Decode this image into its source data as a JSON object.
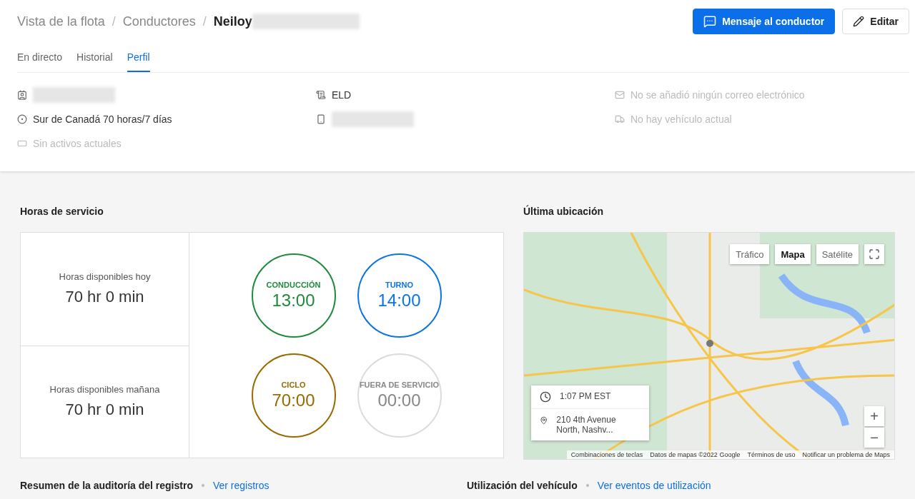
{
  "breadcrumb": {
    "separator": "/",
    "items": [
      {
        "label": "Vista de la flota",
        "current": false
      },
      {
        "label": "Conductores",
        "current": false
      },
      {
        "label": "Neiloy",
        "current": true
      }
    ]
  },
  "actions": {
    "message": "Mensaje al conductor",
    "edit": "Editar"
  },
  "tabs": [
    {
      "label": "En directo",
      "selected": false
    },
    {
      "label": "Historial",
      "selected": false
    },
    {
      "label": "Perfil",
      "selected": true
    }
  ],
  "details": [
    {
      "muted": false,
      "redacted": true
    },
    {
      "text": "ELD",
      "muted": false,
      "redacted": false
    },
    {
      "text": "No se añadió ningún correo electrónico",
      "muted": true,
      "redacted": false
    },
    {
      "text": "Sur de Canadá 70 horas/7 días",
      "muted": false,
      "redacted": false
    },
    {
      "muted": false,
      "redacted": true
    },
    {
      "text": "No hay vehículo actual",
      "muted": true,
      "redacted": false
    },
    {
      "text": "Sin activos actuales",
      "muted": true,
      "redacted": false
    }
  ],
  "hos": {
    "title": "Horas de servicio",
    "available": [
      {
        "label": "Horas disponibles hoy",
        "value": "70 hr 0 min"
      },
      {
        "label": "Horas disponibles mañana",
        "value": "70 hr 0 min"
      }
    ],
    "clocks": [
      {
        "label": "CONDUCCIÓN",
        "time": "13:00",
        "color": "#1e8a3a"
      },
      {
        "label": "TURNO",
        "time": "14:00",
        "color": "#0a74e8"
      },
      {
        "label": "CICLO",
        "time": "70:00",
        "color": "#9a6a00"
      },
      {
        "label": "FUERA DE SERVICIO",
        "time": "00:00",
        "color": "#dcdcdc"
      }
    ]
  },
  "location": {
    "title": "Última ubicación",
    "map_types": [
      {
        "label": "Tráfico",
        "selected": false
      },
      {
        "label": "Mapa",
        "selected": true
      },
      {
        "label": "Satélite",
        "selected": false
      }
    ],
    "time": "1:07 PM EST",
    "address": "210 4th Avenue North, Nashv...",
    "zoom_in": "+",
    "zoom_out": "−",
    "attribution": [
      "Combinaciones de teclas",
      "Datos de mapas ©2022 Google",
      "Términos de uso",
      "Notificar un problema de Maps"
    ]
  },
  "footer": [
    {
      "title": "Resumen de la auditoría del registro",
      "link": "Ver registros"
    },
    {
      "title": "Utilización del vehículo",
      "link": "Ver eventos de utilización"
    }
  ]
}
